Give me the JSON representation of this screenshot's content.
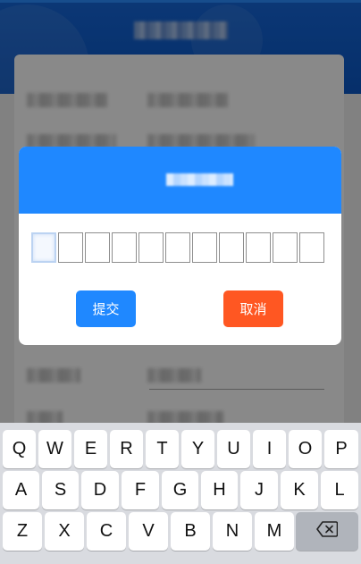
{
  "colors": {
    "primary": "#1f88ff",
    "cancel": "#ff5722",
    "header": "#1565d6"
  },
  "dialog": {
    "title": "",
    "code_length": 11,
    "submit_label": "提交",
    "cancel_label": "取消"
  },
  "keyboard": {
    "row1": [
      "Q",
      "W",
      "E",
      "R",
      "T",
      "Y",
      "U",
      "I",
      "O",
      "P"
    ],
    "row2": [
      "A",
      "S",
      "D",
      "F",
      "G",
      "H",
      "J",
      "K",
      "L"
    ],
    "row3": [
      "Z",
      "X",
      "C",
      "V",
      "B",
      "N",
      "M"
    ],
    "delete_icon": "backspace-icon"
  }
}
